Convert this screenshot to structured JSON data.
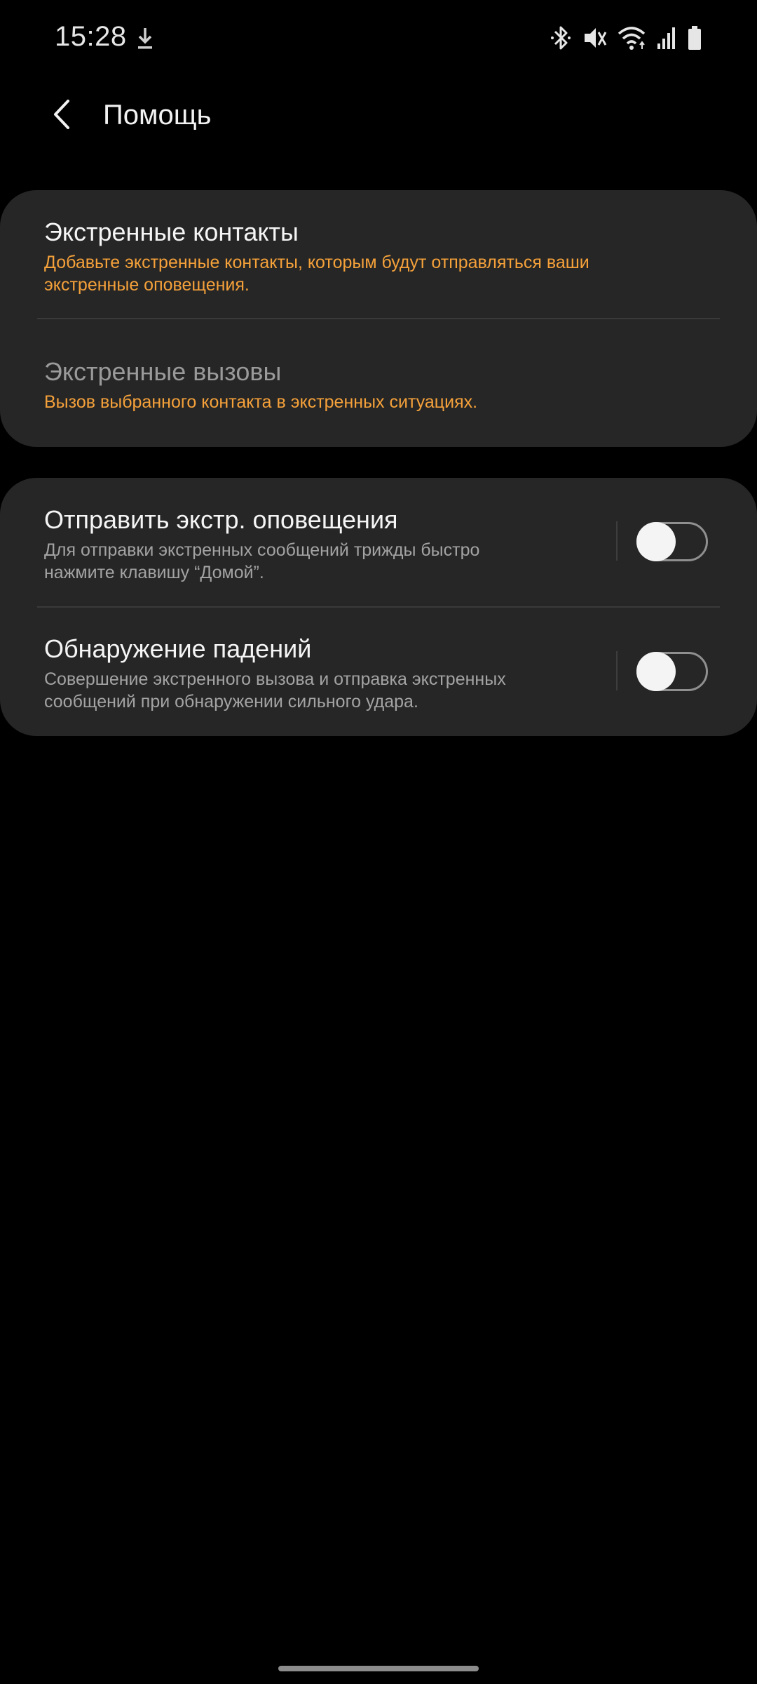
{
  "status_bar": {
    "time": "15:28",
    "icons": [
      "download-icon",
      "bluetooth-icon",
      "vibrate-mute-icon",
      "wifi-icon",
      "signal-icon",
      "battery-icon"
    ]
  },
  "app_bar": {
    "title": "Помощь",
    "back_icon": "chevron-left-icon"
  },
  "sections": {
    "contacts": {
      "emergency_contacts": {
        "title": "Экстренные контакты",
        "subtitle_line1": "Добавьте экстренные контакты, которым будут отправляться ваши",
        "subtitle_line2": "экстренные оповещения."
      },
      "emergency_calls": {
        "title": "Экстренные вызовы",
        "subtitle": "Вызов выбранного контакта в экстренных ситуациях."
      }
    },
    "toggles": {
      "send_alerts": {
        "title": "Отправить экстр. оповещения",
        "subtitle_line1": "Для отправки экстренных сообщений трижды быстро",
        "subtitle_line2": "нажмите клавишу “Домой”.",
        "enabled": false
      },
      "fall_detection": {
        "title": "Обнаружение падений",
        "subtitle_line1": "Совершение экстренного вызова и отправка экстренных",
        "subtitle_line2": "сообщений при обнаружении сильного удара.",
        "enabled": false
      }
    }
  },
  "colors": {
    "background": "#000000",
    "card": "#262626",
    "accent_orange": "#f5a13a",
    "secondary_text": "#a3a3a3"
  }
}
